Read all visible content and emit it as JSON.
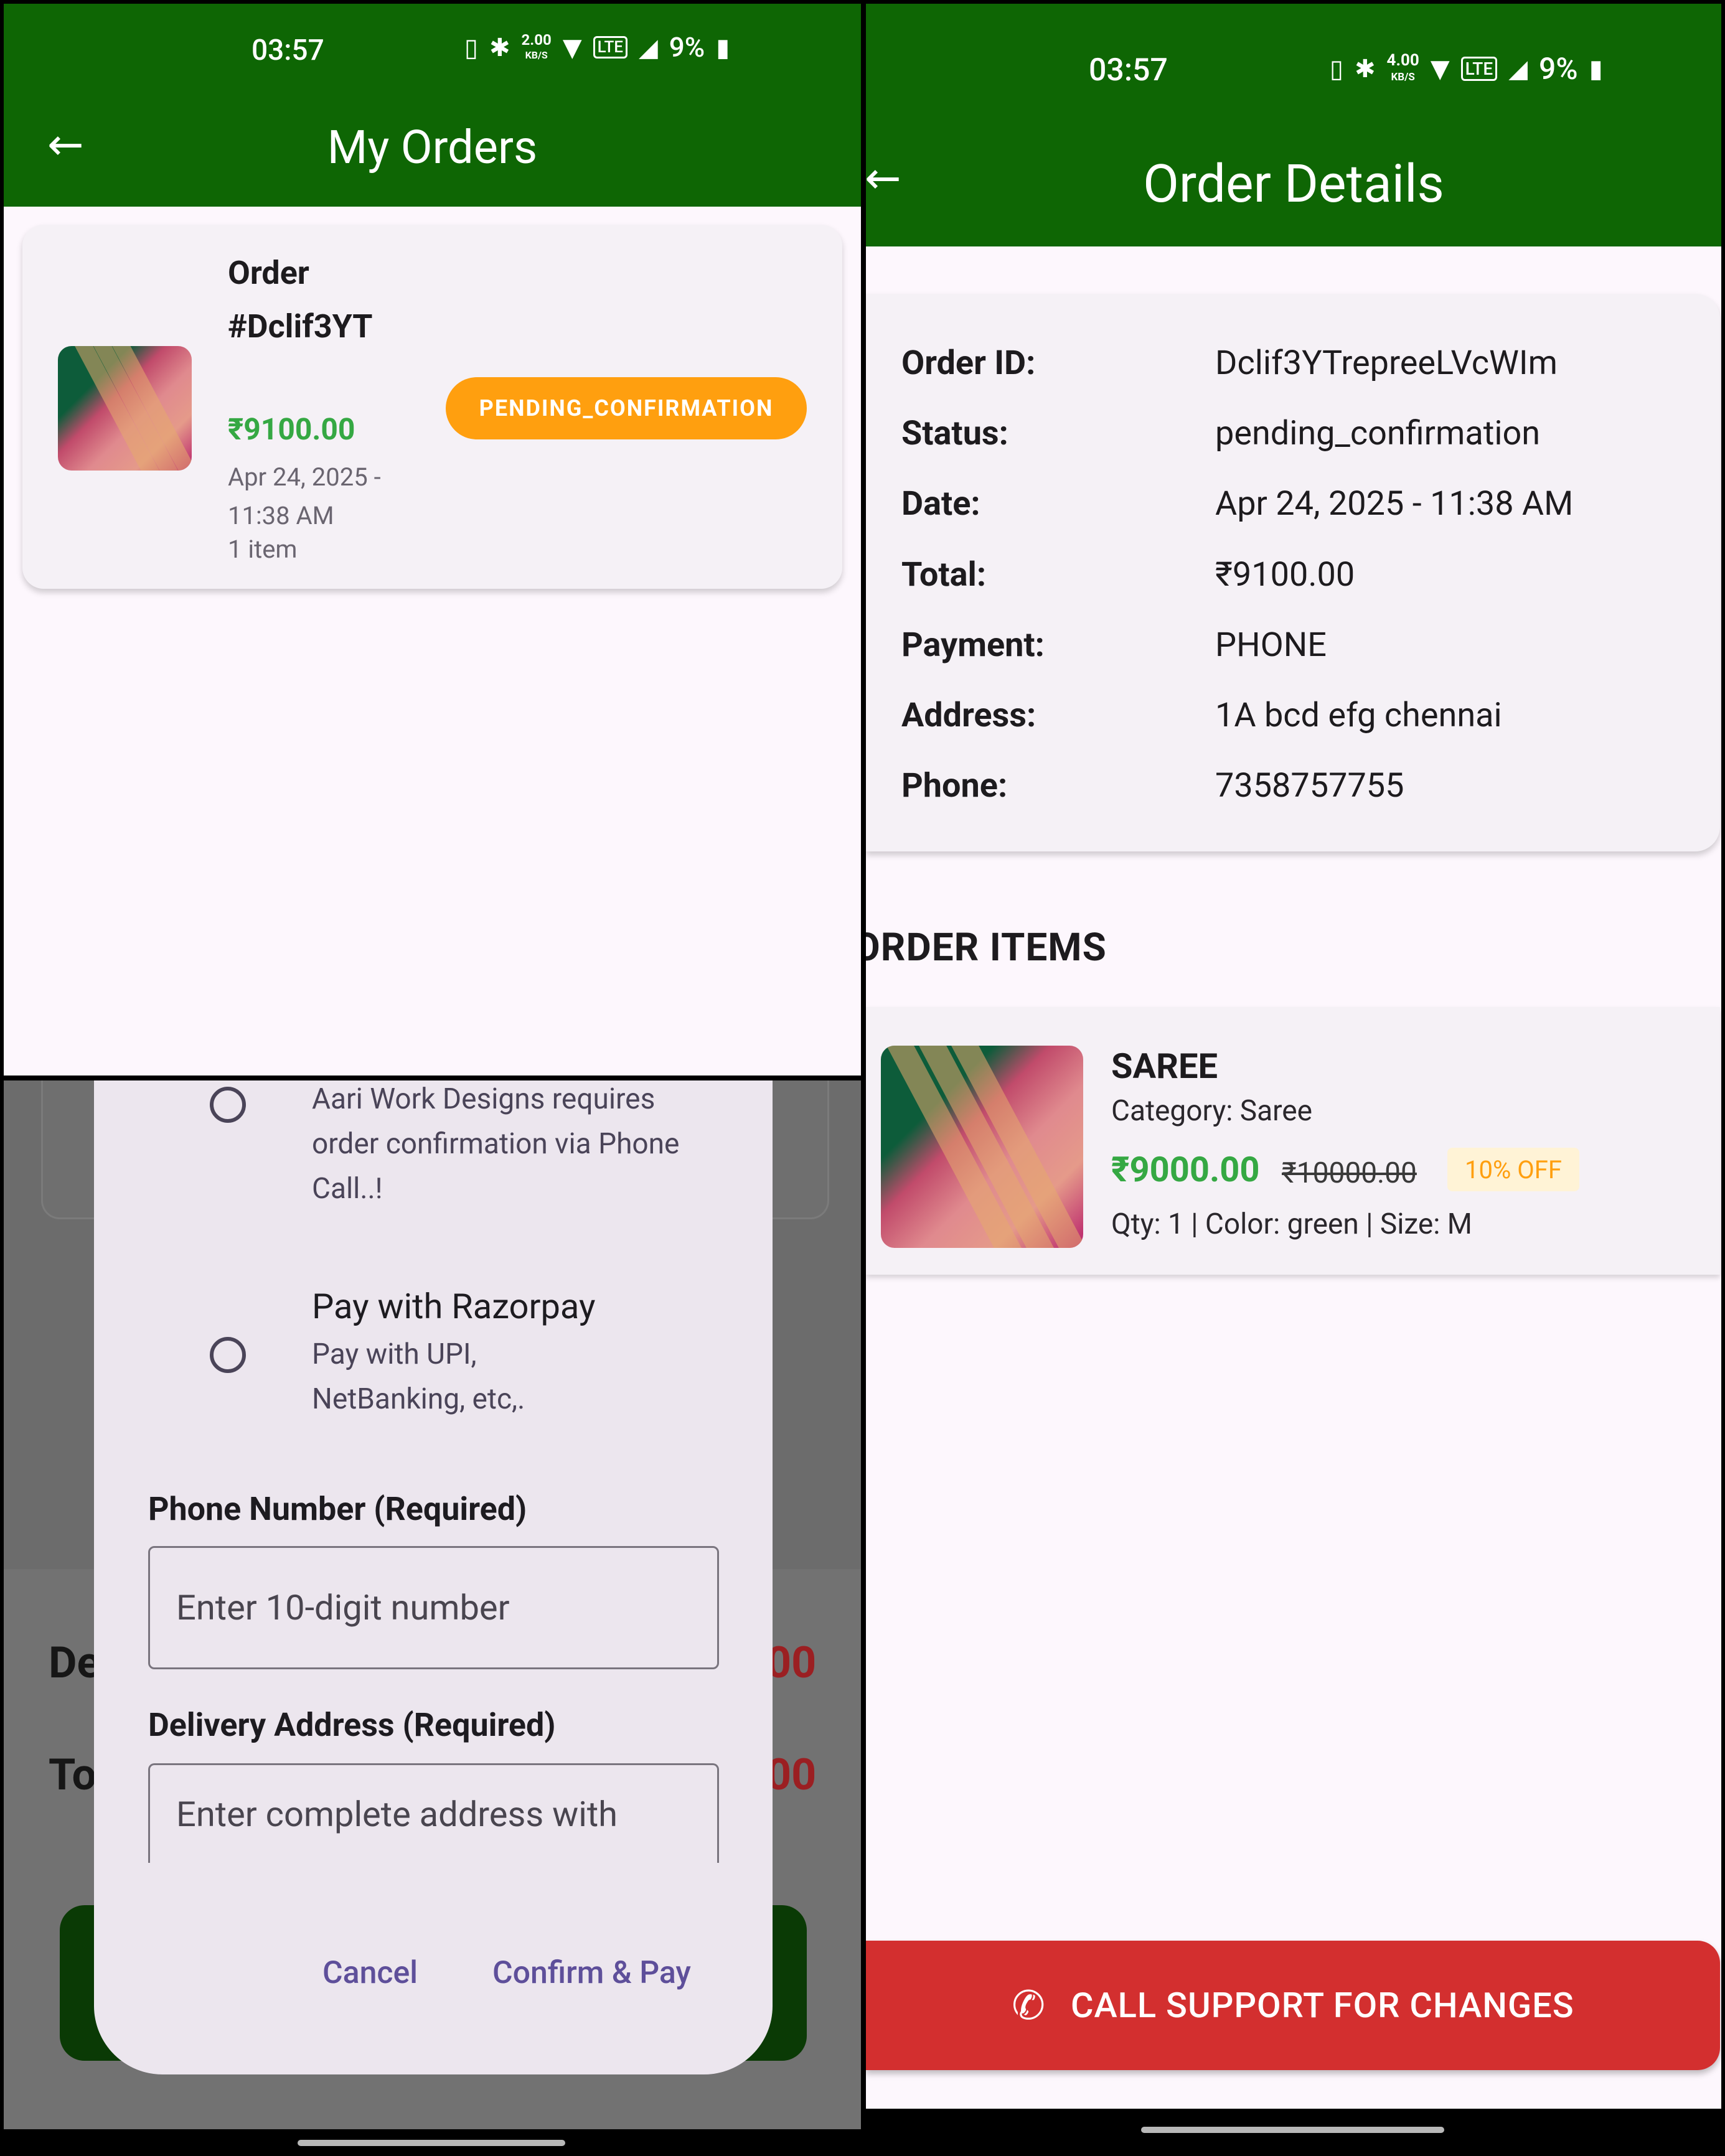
{
  "orders_screen": {
    "status": {
      "time": "03:57",
      "data_rate": "2.00",
      "data_unit": "KB/S",
      "battery": "9%"
    },
    "appbar": {
      "title": "My Orders"
    },
    "order": {
      "title": "Order #Dclif3YT",
      "price": "₹9100.00",
      "date": "Apr 24, 2025 - 11:38 AM",
      "items": "1 item",
      "status": "PENDING_CONFIRMATION"
    }
  },
  "dialog_screen": {
    "option1_desc": "Aari Work Designs requires order confirmation via Phone Call..!",
    "option2_title": "Pay with Razorpay",
    "option2_desc": "Pay with UPI, NetBanking, etc,.",
    "phone_label": "Phone Number (Required)",
    "phone_placeholder": "Enter 10-digit number",
    "address_label": "Delivery Address (Required)",
    "address_placeholder": "Enter complete address with",
    "cancel_label": "Cancel",
    "confirm_label": "Confirm & Pay",
    "background": {
      "label_1": "De",
      "label_2": "To",
      "amount_1": "00",
      "amount_2": "00"
    }
  },
  "details_screen": {
    "status": {
      "time": "03:57",
      "data_rate": "4.00",
      "data_unit": "KB/S",
      "battery": "9%"
    },
    "appbar": {
      "title": "Order Details"
    },
    "fields": [
      {
        "key": "Order ID:",
        "value": "Dclif3YTrepreeLVcWIm"
      },
      {
        "key": "Status:",
        "value": "pending_confirmation"
      },
      {
        "key": "Date:",
        "value": "Apr 24, 2025 - 11:38 AM"
      },
      {
        "key": "Total:",
        "value": "₹9100.00"
      },
      {
        "key": "Payment:",
        "value": "PHONE"
      },
      {
        "key": "Address:",
        "value": "1A bcd efg chennai"
      },
      {
        "key": "Phone:",
        "value": "7358757755"
      }
    ],
    "section_title": "ORDER ITEMS",
    "item": {
      "name": "SAREE",
      "category": "Category: Saree",
      "price": "₹9000.00",
      "mrp": "₹10000.00",
      "discount": "10% OFF",
      "meta": "Qty: 1 | Color: green | Size: M"
    },
    "call_button": "CALL SUPPORT FOR CHANGES"
  },
  "colors": {
    "primary": "#0e6604",
    "pending": "#ff9f0f",
    "price_green": "#35a843",
    "danger": "#d32f2f",
    "dialog_action": "#5e4f9a"
  },
  "icons": [
    "back-arrow-icon",
    "vibrate-icon",
    "bluetooth-icon",
    "wifi-icon",
    "volte-icon",
    "signal-icon",
    "battery-charging-icon",
    "phone-icon",
    "radio-unselected-icon"
  ]
}
